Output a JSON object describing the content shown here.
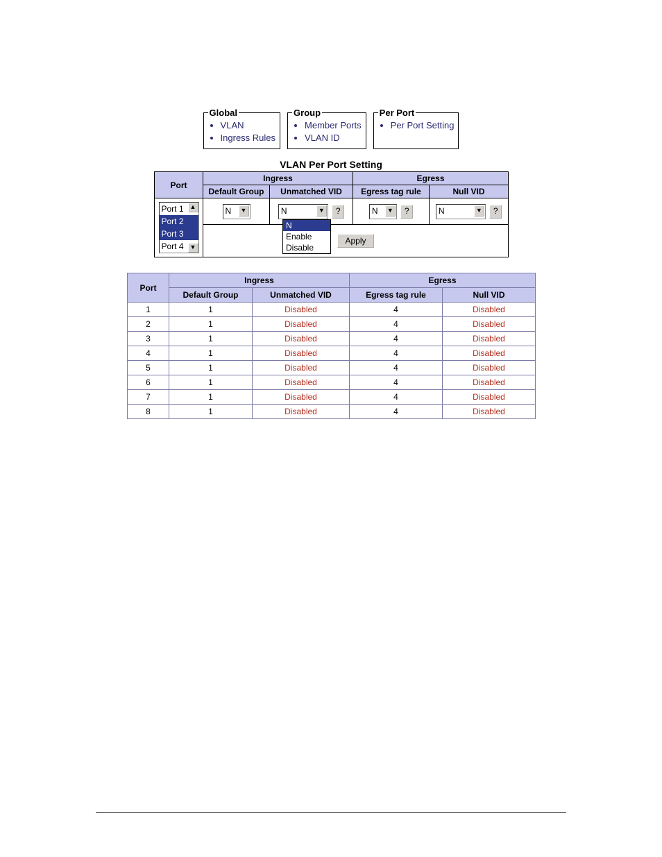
{
  "nav": {
    "global": {
      "legend": "Global",
      "items": [
        "VLAN",
        "Ingress Rules"
      ]
    },
    "group": {
      "legend": "Group",
      "items": [
        "Member Ports",
        "VLAN ID"
      ]
    },
    "perport": {
      "legend": "Per Port",
      "items": [
        "Per Port Setting"
      ]
    }
  },
  "section_title": "VLAN Per Port Setting",
  "config_table": {
    "headers": {
      "port": "Port",
      "ingress": "Ingress",
      "egress": "Egress",
      "default_group": "Default Group",
      "unmatched_vid": "Unmatched VID",
      "egress_tag_rule": "Egress tag rule",
      "null_vid": "Null VID"
    },
    "port_list": {
      "options": [
        "Port 1",
        "Port 2",
        "Port 3",
        "Port 4"
      ],
      "selected": [
        1,
        2
      ],
      "scroll_up": "▲",
      "scroll_dn": "▼"
    },
    "default_group": {
      "value": "N",
      "caret": "▼"
    },
    "unmatched_vid": {
      "value": "N",
      "caret": "▼",
      "help": "?",
      "dropdown_open": true,
      "options": [
        "N",
        "Enable",
        "Disable"
      ],
      "highlight_index": 0
    },
    "egress_tag_rule": {
      "value": "N",
      "caret": "▼",
      "help": "?"
    },
    "null_vid": {
      "value": "N",
      "caret": "▼",
      "help": "?"
    },
    "apply_label": "Apply"
  },
  "status_table": {
    "headers": {
      "port": "Port",
      "ingress": "Ingress",
      "egress": "Egress",
      "default_group": "Default Group",
      "unmatched_vid": "Unmatched VID",
      "egress_tag_rule": "Egress tag rule",
      "null_vid": "Null VID"
    },
    "rows": [
      {
        "port": "1",
        "default_group": "1",
        "unmatched_vid": "Disabled",
        "egress_tag_rule": "4",
        "null_vid": "Disabled"
      },
      {
        "port": "2",
        "default_group": "1",
        "unmatched_vid": "Disabled",
        "egress_tag_rule": "4",
        "null_vid": "Disabled"
      },
      {
        "port": "3",
        "default_group": "1",
        "unmatched_vid": "Disabled",
        "egress_tag_rule": "4",
        "null_vid": "Disabled"
      },
      {
        "port": "4",
        "default_group": "1",
        "unmatched_vid": "Disabled",
        "egress_tag_rule": "4",
        "null_vid": "Disabled"
      },
      {
        "port": "5",
        "default_group": "1",
        "unmatched_vid": "Disabled",
        "egress_tag_rule": "4",
        "null_vid": "Disabled"
      },
      {
        "port": "6",
        "default_group": "1",
        "unmatched_vid": "Disabled",
        "egress_tag_rule": "4",
        "null_vid": "Disabled"
      },
      {
        "port": "7",
        "default_group": "1",
        "unmatched_vid": "Disabled",
        "egress_tag_rule": "4",
        "null_vid": "Disabled"
      },
      {
        "port": "8",
        "default_group": "1",
        "unmatched_vid": "Disabled",
        "egress_tag_rule": "4",
        "null_vid": "Disabled"
      }
    ]
  }
}
